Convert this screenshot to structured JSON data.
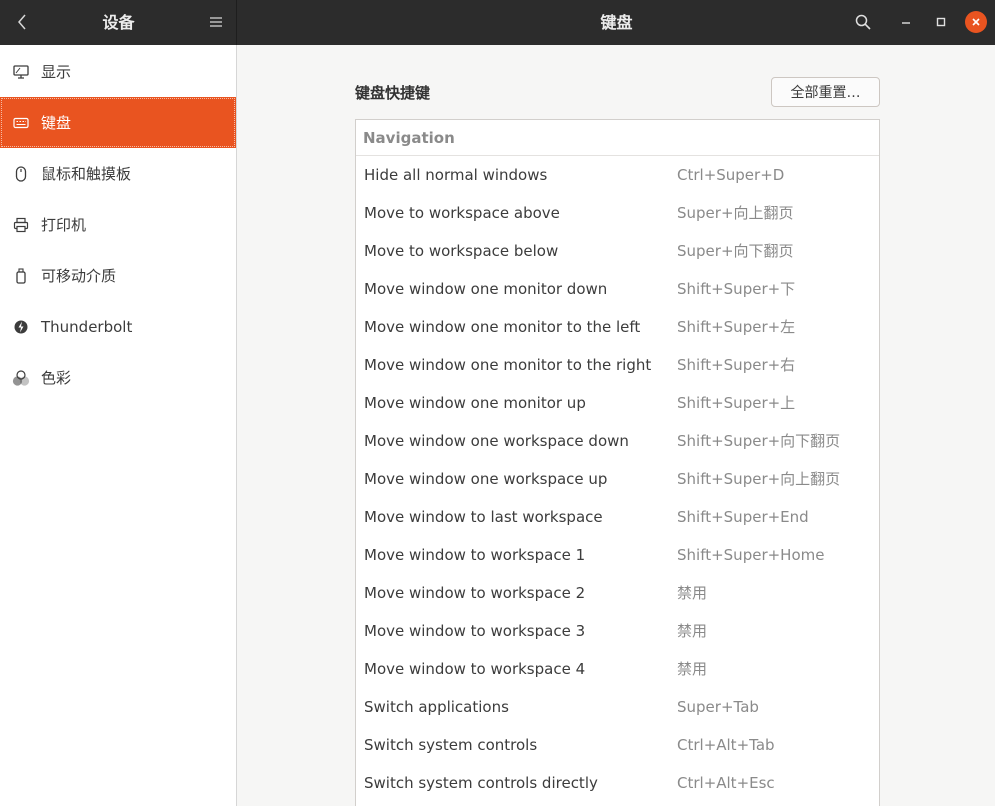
{
  "header": {
    "sidebar_title": "设备",
    "title": "键盘",
    "icons": {
      "back": "chevron-left-icon",
      "menu": "hamburger-menu-icon",
      "search": "search-icon",
      "minimize": "minimize-icon",
      "maximize": "maximize-icon",
      "close": "close-icon"
    },
    "close_color": "#e95420"
  },
  "sidebar": {
    "accent": "#e95420",
    "items": [
      {
        "label": "显示",
        "icon": "display-icon",
        "active": false
      },
      {
        "label": "键盘",
        "icon": "keyboard-icon",
        "active": true
      },
      {
        "label": "鼠标和触摸板",
        "icon": "mouse-icon",
        "active": false
      },
      {
        "label": "打印机",
        "icon": "printer-icon",
        "active": false
      },
      {
        "label": "可移动介质",
        "icon": "removable-media-icon",
        "active": false
      },
      {
        "label": "Thunderbolt",
        "icon": "thunderbolt-icon",
        "active": false
      },
      {
        "label": "色彩",
        "icon": "color-icon",
        "active": false
      }
    ]
  },
  "main": {
    "section_title": "键盘快捷键",
    "reset_button": "全部重置…",
    "category": "Navigation",
    "shortcuts": [
      {
        "name": "Hide all normal windows",
        "accel": "Ctrl+Super+D"
      },
      {
        "name": "Move to workspace above",
        "accel": "Super+向上翻页"
      },
      {
        "name": "Move to workspace below",
        "accel": "Super+向下翻页"
      },
      {
        "name": "Move window one monitor down",
        "accel": "Shift+Super+下"
      },
      {
        "name": "Move window one monitor to the left",
        "accel": "Shift+Super+左"
      },
      {
        "name": "Move window one monitor to the right",
        "accel": "Shift+Super+右"
      },
      {
        "name": "Move window one monitor up",
        "accel": "Shift+Super+上"
      },
      {
        "name": "Move window one workspace down",
        "accel": "Shift+Super+向下翻页"
      },
      {
        "name": "Move window one workspace up",
        "accel": "Shift+Super+向上翻页"
      },
      {
        "name": "Move window to last workspace",
        "accel": "Shift+Super+End"
      },
      {
        "name": "Move window to workspace 1",
        "accel": "Shift+Super+Home"
      },
      {
        "name": "Move window to workspace 2",
        "accel": "禁用"
      },
      {
        "name": "Move window to workspace 3",
        "accel": "禁用"
      },
      {
        "name": "Move window to workspace 4",
        "accel": "禁用"
      },
      {
        "name": "Switch applications",
        "accel": "Super+Tab"
      },
      {
        "name": "Switch system controls",
        "accel": "Ctrl+Alt+Tab"
      },
      {
        "name": "Switch system controls directly",
        "accel": "Ctrl+Alt+Esc"
      }
    ]
  }
}
